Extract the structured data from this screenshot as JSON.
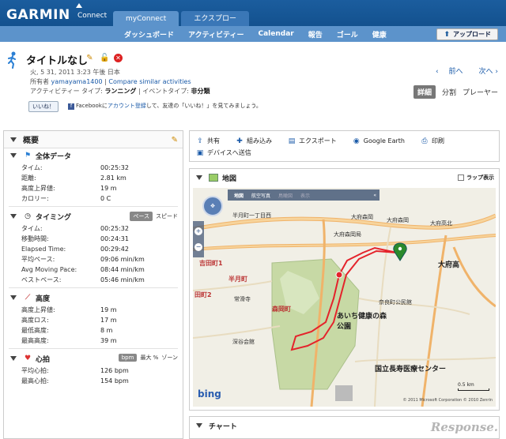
{
  "header": {
    "logo": "GARMIN",
    "logo_sub": "Connect",
    "tabs": [
      {
        "label": "myConnect",
        "active": true
      },
      {
        "label": "エクスプロー",
        "active": false
      }
    ],
    "subnav": [
      "ダッシュボード",
      "アクティビティー",
      "Calendar",
      "報告",
      "ゴール",
      "健康"
    ],
    "upload_label": "アップロード"
  },
  "activity": {
    "title": "タイトルなし",
    "date": "火, 5 31, 2011 3:23 午後 日本",
    "owner_label": "所有者",
    "owner": "yamayama1400",
    "compare": "Compare similar activities",
    "type_label": "アクティビティー タイプ:",
    "type": "ランニング",
    "event_label": "イベントタイプ:",
    "event": "非分類",
    "like_label": "いいね！",
    "fb_prefix": "Facebookに",
    "fb_link": "アカウント登録",
    "fb_suffix": "して、友達の「いいね！」を見てみましょう。",
    "prev": "前へ",
    "next": "次へ",
    "view_tabs": [
      "詳細",
      "分割",
      "プレーヤー"
    ]
  },
  "summary": {
    "title": "概要",
    "overall": {
      "title": "全体データ",
      "rows": [
        {
          "label": "タイム:",
          "value": "00:25:32"
        },
        {
          "label": "距離:",
          "value": "2.81 km"
        },
        {
          "label": "高度上昇値:",
          "value": "19 m"
        },
        {
          "label": "カロリー:",
          "value": "0 C"
        }
      ]
    },
    "timing": {
      "title": "タイミング",
      "toggles": [
        "ペース",
        "スピード"
      ],
      "rows": [
        {
          "label": "タイム:",
          "value": "00:25:32"
        },
        {
          "label": "移動時間:",
          "value": "00:24:31"
        },
        {
          "label": "Elapsed Time:",
          "value": "00:29:42"
        },
        {
          "label": "平均ペース:",
          "value": "09:06 min/km"
        },
        {
          "label": "Avg Moving Pace:",
          "value": "08:44 min/km"
        },
        {
          "label": "ベストペース:",
          "value": "05:46 min/km"
        }
      ]
    },
    "elevation": {
      "title": "高度",
      "rows": [
        {
          "label": "高度上昇値:",
          "value": "19 m"
        },
        {
          "label": "高度ロス:",
          "value": "17 m"
        },
        {
          "label": "最低高度:",
          "value": "8 m"
        },
        {
          "label": "最高高度:",
          "value": "39 m"
        }
      ]
    },
    "heart": {
      "title": "心拍",
      "toggles": [
        "bpm",
        "最大 %",
        "ゾーン"
      ],
      "rows": [
        {
          "label": "平均心拍:",
          "value": "126 bpm"
        },
        {
          "label": "最高心拍:",
          "value": "154 bpm"
        }
      ]
    }
  },
  "actions": [
    {
      "label": "共有",
      "icon": "share-icon"
    },
    {
      "label": "組み込み",
      "icon": "embed-icon"
    },
    {
      "label": "エクスポート",
      "icon": "export-icon"
    },
    {
      "label": "Google Earth",
      "icon": "google-earth-icon"
    },
    {
      "label": "印刷",
      "icon": "print-icon"
    },
    {
      "label": "デバイスへ送信",
      "icon": "send-device-icon"
    }
  ],
  "map": {
    "title": "地図",
    "lap_label": "ラップ表示",
    "toolbar": [
      "地図",
      "航空写真",
      "鳥瞰図",
      "表示"
    ],
    "labels": {
      "l1": "半月町一丁目西",
      "l2": "大府森岡",
      "l3": "大府森岡局",
      "l4": "大府高北",
      "l5": "大府高",
      "l6": "吉田町1",
      "l7": "半月町",
      "l8": "常滑寺",
      "l9": "田町2",
      "l10": "森岡町",
      "l11": "あいち健康の森公園",
      "l12": "深谷会館",
      "l13": "国立長寿医療センター",
      "l14": "奈良町公民館",
      "l15": "大府森岡"
    },
    "bing": "bing",
    "scale": "0.5 km",
    "copyright": "© 2011 Microsoft Corporation  © 2010 Zenrin"
  },
  "chart": {
    "title": "チャート"
  },
  "watermark": "Response."
}
